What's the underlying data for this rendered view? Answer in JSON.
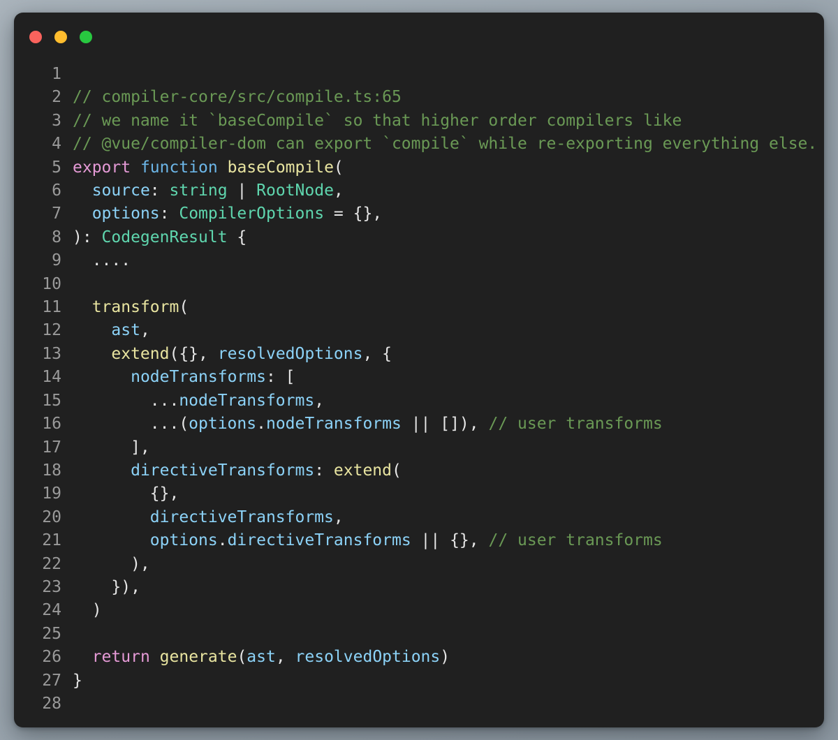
{
  "window": {
    "traffic_lights": [
      {
        "name": "close-button",
        "color": "#fa635d"
      },
      {
        "name": "minimize-button",
        "color": "#ffbd2e"
      },
      {
        "name": "maximize-button",
        "color": "#28c840"
      }
    ],
    "background": "#202020",
    "page_background": "#9ba6af"
  },
  "theme": {
    "comment": "#6a9955",
    "keyword": "#e59ad6",
    "storage": "#6cb6e8",
    "function": "#e8e4a0",
    "variable": "#8cd2f7",
    "type": "#5fd6ae",
    "plain": "#e6e6e6",
    "line_number": "#9a9a9a"
  },
  "code": {
    "language": "typescript",
    "first_line_number": 1,
    "last_line_number": 28,
    "lines": [
      {
        "n": "1",
        "tokens": []
      },
      {
        "n": "2",
        "tokens": [
          {
            "t": "// compiler-core/src/compile.ts:65",
            "c": "t-comment"
          }
        ]
      },
      {
        "n": "3",
        "tokens": [
          {
            "t": "// we name it `baseCompile` so that higher order compilers like",
            "c": "t-comment"
          }
        ]
      },
      {
        "n": "4",
        "tokens": [
          {
            "t": "// @vue/compiler-dom can export `compile` while re-exporting everything else.",
            "c": "t-comment"
          }
        ]
      },
      {
        "n": "5",
        "tokens": [
          {
            "t": "export",
            "c": "t-keyword"
          },
          {
            "t": " ",
            "c": "t-plain"
          },
          {
            "t": "function",
            "c": "t-storage"
          },
          {
            "t": " ",
            "c": "t-plain"
          },
          {
            "t": "baseCompile",
            "c": "t-func"
          },
          {
            "t": "(",
            "c": "t-punct"
          }
        ]
      },
      {
        "n": "6",
        "tokens": [
          {
            "t": "  ",
            "c": "t-plain"
          },
          {
            "t": "source",
            "c": "t-var"
          },
          {
            "t": ": ",
            "c": "t-punct"
          },
          {
            "t": "string",
            "c": "t-type"
          },
          {
            "t": " | ",
            "c": "t-op"
          },
          {
            "t": "RootNode",
            "c": "t-type"
          },
          {
            "t": ",",
            "c": "t-punct"
          }
        ]
      },
      {
        "n": "7",
        "tokens": [
          {
            "t": "  ",
            "c": "t-plain"
          },
          {
            "t": "options",
            "c": "t-var"
          },
          {
            "t": ": ",
            "c": "t-punct"
          },
          {
            "t": "CompilerOptions",
            "c": "t-type"
          },
          {
            "t": " = {},",
            "c": "t-punct"
          }
        ]
      },
      {
        "n": "8",
        "tokens": [
          {
            "t": "): ",
            "c": "t-punct"
          },
          {
            "t": "CodegenResult",
            "c": "t-type"
          },
          {
            "t": " {",
            "c": "t-punct"
          }
        ]
      },
      {
        "n": "9",
        "tokens": [
          {
            "t": "  ....",
            "c": "t-plain"
          }
        ]
      },
      {
        "n": "10",
        "tokens": []
      },
      {
        "n": "11",
        "tokens": [
          {
            "t": "  ",
            "c": "t-plain"
          },
          {
            "t": "transform",
            "c": "t-func"
          },
          {
            "t": "(",
            "c": "t-punct"
          }
        ]
      },
      {
        "n": "12",
        "tokens": [
          {
            "t": "    ",
            "c": "t-plain"
          },
          {
            "t": "ast",
            "c": "t-var"
          },
          {
            "t": ",",
            "c": "t-punct"
          }
        ]
      },
      {
        "n": "13",
        "tokens": [
          {
            "t": "    ",
            "c": "t-plain"
          },
          {
            "t": "extend",
            "c": "t-func"
          },
          {
            "t": "({}, ",
            "c": "t-punct"
          },
          {
            "t": "resolvedOptions",
            "c": "t-var"
          },
          {
            "t": ", {",
            "c": "t-punct"
          }
        ]
      },
      {
        "n": "14",
        "tokens": [
          {
            "t": "      ",
            "c": "t-plain"
          },
          {
            "t": "nodeTransforms",
            "c": "t-var"
          },
          {
            "t": ": [",
            "c": "t-punct"
          }
        ]
      },
      {
        "n": "15",
        "tokens": [
          {
            "t": "        ...",
            "c": "t-punct"
          },
          {
            "t": "nodeTransforms",
            "c": "t-var"
          },
          {
            "t": ",",
            "c": "t-punct"
          }
        ]
      },
      {
        "n": "16",
        "tokens": [
          {
            "t": "        ...(",
            "c": "t-punct"
          },
          {
            "t": "options",
            "c": "t-var"
          },
          {
            "t": ".",
            "c": "t-punct"
          },
          {
            "t": "nodeTransforms",
            "c": "t-var"
          },
          {
            "t": " || []), ",
            "c": "t-op"
          },
          {
            "t": "// user transforms",
            "c": "t-comment"
          }
        ]
      },
      {
        "n": "17",
        "tokens": [
          {
            "t": "      ],",
            "c": "t-punct"
          }
        ]
      },
      {
        "n": "18",
        "tokens": [
          {
            "t": "      ",
            "c": "t-plain"
          },
          {
            "t": "directiveTransforms",
            "c": "t-var"
          },
          {
            "t": ": ",
            "c": "t-punct"
          },
          {
            "t": "extend",
            "c": "t-func"
          },
          {
            "t": "(",
            "c": "t-punct"
          }
        ]
      },
      {
        "n": "19",
        "tokens": [
          {
            "t": "        {},",
            "c": "t-punct"
          }
        ]
      },
      {
        "n": "20",
        "tokens": [
          {
            "t": "        ",
            "c": "t-plain"
          },
          {
            "t": "directiveTransforms",
            "c": "t-var"
          },
          {
            "t": ",",
            "c": "t-punct"
          }
        ]
      },
      {
        "n": "21",
        "tokens": [
          {
            "t": "        ",
            "c": "t-plain"
          },
          {
            "t": "options",
            "c": "t-var"
          },
          {
            "t": ".",
            "c": "t-punct"
          },
          {
            "t": "directiveTransforms",
            "c": "t-var"
          },
          {
            "t": " || {}, ",
            "c": "t-op"
          },
          {
            "t": "// user transforms",
            "c": "t-comment"
          }
        ]
      },
      {
        "n": "22",
        "tokens": [
          {
            "t": "      ),",
            "c": "t-punct"
          }
        ]
      },
      {
        "n": "23",
        "tokens": [
          {
            "t": "    }),",
            "c": "t-punct"
          }
        ]
      },
      {
        "n": "24",
        "tokens": [
          {
            "t": "  )",
            "c": "t-punct"
          }
        ]
      },
      {
        "n": "25",
        "tokens": []
      },
      {
        "n": "26",
        "tokens": [
          {
            "t": "  ",
            "c": "t-plain"
          },
          {
            "t": "return",
            "c": "t-keyword"
          },
          {
            "t": " ",
            "c": "t-plain"
          },
          {
            "t": "generate",
            "c": "t-func"
          },
          {
            "t": "(",
            "c": "t-punct"
          },
          {
            "t": "ast",
            "c": "t-var"
          },
          {
            "t": ", ",
            "c": "t-punct"
          },
          {
            "t": "resolvedOptions",
            "c": "t-var"
          },
          {
            "t": ")",
            "c": "t-punct"
          }
        ]
      },
      {
        "n": "27",
        "tokens": [
          {
            "t": "}",
            "c": "t-punct"
          }
        ]
      },
      {
        "n": "28",
        "tokens": []
      }
    ]
  }
}
